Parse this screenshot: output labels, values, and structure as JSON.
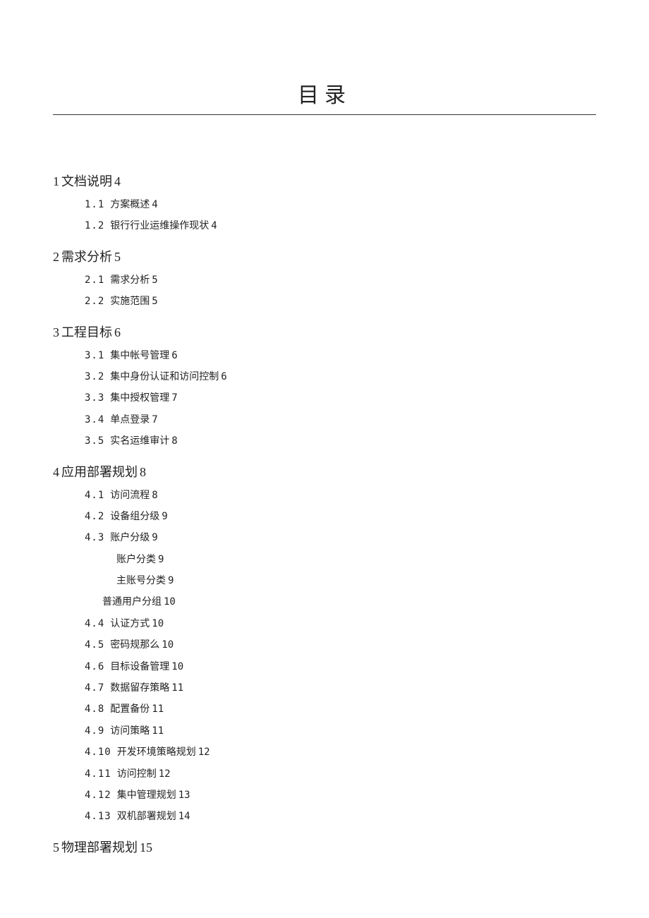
{
  "title": "目录",
  "toc": [
    {
      "level": 1,
      "num": "1",
      "label": "文档说明",
      "page": "4"
    },
    {
      "level": 2,
      "num": "1.1",
      "label": "方案概述",
      "page": "4"
    },
    {
      "level": 2,
      "num": "1.2",
      "label": "银行行业运维操作现状",
      "page": "4"
    },
    {
      "level": 1,
      "num": "2",
      "label": "需求分析",
      "page": "5"
    },
    {
      "level": 2,
      "num": "2.1",
      "label": "需求分析",
      "page": "5"
    },
    {
      "level": 2,
      "num": "2.2",
      "label": "实施范围",
      "page": "5"
    },
    {
      "level": 1,
      "num": "3",
      "label": "工程目标",
      "page": "6"
    },
    {
      "level": 2,
      "num": "3.1",
      "label": "集中帐号管理",
      "page": "6"
    },
    {
      "level": 2,
      "num": "3.2",
      "label": "集中身份认证和访问控制",
      "page": "6"
    },
    {
      "level": 2,
      "num": "3.3",
      "label": "集中授权管理",
      "page": "7"
    },
    {
      "level": 2,
      "num": "3.4",
      "label": "单点登录",
      "page": "7"
    },
    {
      "level": 2,
      "num": "3.5",
      "label": "实名运维审计",
      "page": "8"
    },
    {
      "level": 1,
      "num": "4",
      "label": "应用部署规划",
      "page": "8"
    },
    {
      "level": 2,
      "num": "4.1",
      "label": "访问流程",
      "page": "8"
    },
    {
      "level": 2,
      "num": "4.2",
      "label": "设备组分级",
      "page": "9"
    },
    {
      "level": 2,
      "num": "4.3",
      "label": "账户分级",
      "page": "9"
    },
    {
      "level": 3,
      "num": "",
      "label": "账户分类",
      "page": "9"
    },
    {
      "level": 3,
      "num": "",
      "label": "主账号分类",
      "page": "9"
    },
    {
      "level": 3,
      "num": "",
      "label": "普通用户分组",
      "page": "10",
      "outdent": true
    },
    {
      "level": 2,
      "num": "4.4",
      "label": "认证方式",
      "page": "10"
    },
    {
      "level": 2,
      "num": "4.5",
      "label": "密码规那么",
      "page": "10"
    },
    {
      "level": 2,
      "num": "4.6",
      "label": "目标设备管理",
      "page": "10"
    },
    {
      "level": 2,
      "num": "4.7",
      "label": "数据留存策略",
      "page": "11"
    },
    {
      "level": 2,
      "num": "4.8",
      "label": "配置备份",
      "page": "11"
    },
    {
      "level": 2,
      "num": "4.9",
      "label": "访问策略",
      "page": "11"
    },
    {
      "level": 2,
      "num": "4.10",
      "label": "开发环境策略规划",
      "page": "12"
    },
    {
      "level": 2,
      "num": "4.11",
      "label": "访问控制",
      "page": "12"
    },
    {
      "level": 2,
      "num": "4.12",
      "label": "集中管理规划",
      "page": "13"
    },
    {
      "level": 2,
      "num": "4.13",
      "label": "双机部署规划",
      "page": "14"
    },
    {
      "level": 1,
      "num": "5",
      "label": "物理部署规划",
      "page": "15"
    }
  ]
}
